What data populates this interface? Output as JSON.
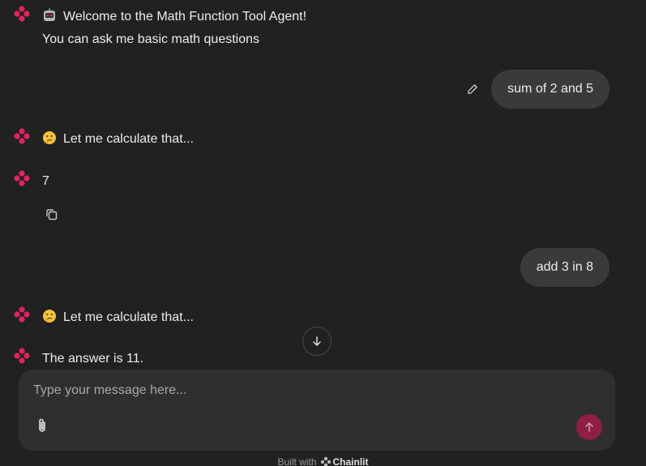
{
  "messages": [
    {
      "role": "assistant",
      "emoji": "robot-face",
      "lines": [
        "Welcome to the Math Function Tool Agent!",
        "You can ask me basic math questions"
      ]
    },
    {
      "role": "user",
      "text": "sum of 2 and 5"
    },
    {
      "role": "assistant",
      "emoji": "thinking-face",
      "text": "Let me calculate that..."
    },
    {
      "role": "assistant",
      "text": "7"
    },
    {
      "role": "user",
      "text": "add 3 in 8"
    },
    {
      "role": "assistant",
      "emoji": "thinking-face",
      "text": "Let me calculate that..."
    },
    {
      "role": "assistant",
      "text": "The answer is 11."
    }
  ],
  "composer": {
    "placeholder": "Type your message here..."
  },
  "footer": {
    "prefix": "Built with",
    "brand": "Chainlit"
  },
  "icons": [
    "assistant-avatar-icon",
    "edit-icon",
    "copy-icon",
    "arrow-down-icon",
    "paperclip-icon",
    "arrow-up-icon"
  ],
  "colors": {
    "background": "#212121",
    "bubble": "#3a3a3a",
    "composer": "#2f2f2f",
    "accent": "#e0245e",
    "send": "#8f1f44"
  }
}
